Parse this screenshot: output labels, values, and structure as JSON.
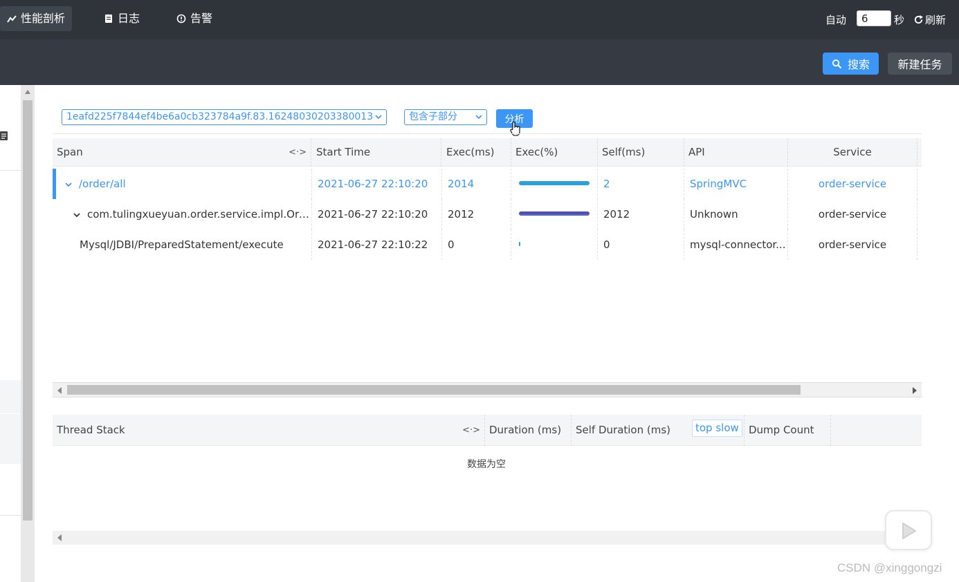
{
  "nav": {
    "items": [
      {
        "label": "性能剖析",
        "icon": "trend-icon"
      },
      {
        "label": "日志",
        "icon": "document-icon"
      },
      {
        "label": "告警",
        "icon": "alert-icon"
      }
    ]
  },
  "refresh_bar": {
    "auto_label": "自动",
    "interval_value": "6",
    "seconds_label": "秒",
    "refresh_label": "刷新"
  },
  "toolbar": {
    "search_label": "搜索",
    "new_task_label": "新建任务"
  },
  "analysis": {
    "trace_select": "1eafd225f7844ef4be6a0cb323784a9f.83.16248030203380013",
    "mode_select": "包含子部分",
    "analyze_label": "分析"
  },
  "span_table": {
    "columns": [
      "Span",
      "Start Time",
      "Exec(ms)",
      "Exec(%)",
      "Self(ms)",
      "API",
      "Service"
    ],
    "resize_glyph": "<·>",
    "rows": [
      {
        "span": "/order/all",
        "start": "2021-06-27 22:10:20",
        "exec": "2014",
        "exec_pct": 1.0,
        "self": "2",
        "api": "SpringMVC",
        "service": "order-service"
      },
      {
        "span": "com.tulingxueyuan.order.service.impl.Ord...",
        "start": "2021-06-27 22:10:20",
        "exec": "2012",
        "exec_pct": 0.999,
        "self": "2012",
        "api": "Unknown",
        "service": "order-service"
      },
      {
        "span": "Mysql/JDBI/PreparedStatement/execute",
        "start": "2021-06-27 22:10:22",
        "exec": "0",
        "exec_pct": 0.0,
        "self": "0",
        "api": "mysql-connector...",
        "service": "order-service"
      }
    ]
  },
  "stack_table": {
    "columns": [
      "Thread Stack",
      "Duration (ms)",
      "Self Duration (ms)",
      "Dump Count"
    ],
    "top_slow_label": "top slow",
    "empty_text": "数据为空"
  },
  "watermark": "CSDN @xinggongzi",
  "colors": {
    "accent": "#3b96f5",
    "topbar": "#2f343b",
    "subbar": "#363b43"
  }
}
